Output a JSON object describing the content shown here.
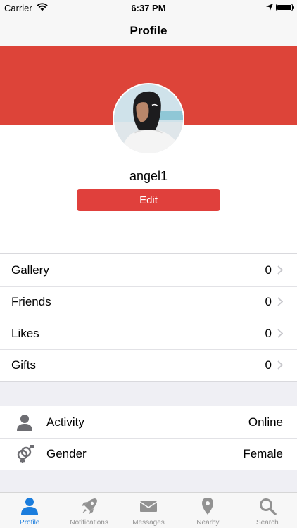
{
  "status_bar": {
    "carrier": "Carrier",
    "time": "6:37 PM"
  },
  "nav": {
    "title": "Profile"
  },
  "profile": {
    "username": "angel1",
    "edit_label": "Edit",
    "cover_color": "#dd4439",
    "button_color": "#e0403c"
  },
  "stats": [
    {
      "label": "Gallery",
      "value": "0"
    },
    {
      "label": "Friends",
      "value": "0"
    },
    {
      "label": "Likes",
      "value": "0"
    },
    {
      "label": "Gifts",
      "value": "0"
    }
  ],
  "info": [
    {
      "label": "Activity",
      "value": "Online",
      "icon": "person-icon"
    },
    {
      "label": "Gender",
      "value": "Female",
      "icon": "gender-icon"
    }
  ],
  "tabs": [
    {
      "label": "Profile",
      "icon": "person-icon",
      "active": true
    },
    {
      "label": "Notifications",
      "icon": "rocket-icon",
      "active": false
    },
    {
      "label": "Messages",
      "icon": "envelope-icon",
      "active": false
    },
    {
      "label": "Nearby",
      "icon": "location-pin-icon",
      "active": false
    },
    {
      "label": "Search",
      "icon": "magnifier-icon",
      "active": false
    }
  ],
  "colors": {
    "accent": "#1b7ddd",
    "inactive_tab": "#929292"
  }
}
